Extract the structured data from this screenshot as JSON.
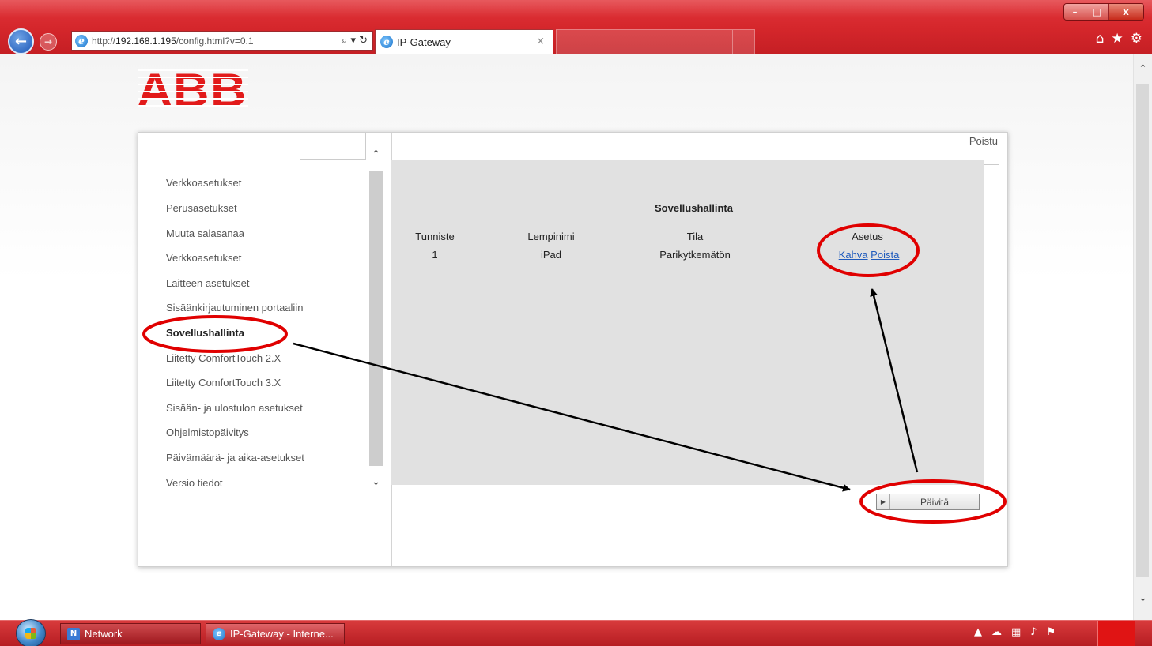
{
  "browser": {
    "url_prefix": "http://",
    "url_host": "192.168.1.195",
    "url_path": "/config.html?v=0.1",
    "tab_title": "IP-Gateway",
    "search_glyph": "⌕ ▾ ↻",
    "tab_close_glyph": "×",
    "toolbar_icons": [
      "home-icon",
      "favorites-icon",
      "tools-icon"
    ],
    "window_controls": [
      "–",
      "□",
      "x"
    ]
  },
  "logo": {
    "letters": [
      "A",
      "B",
      "B"
    ],
    "color": "#e21b1b"
  },
  "sidebar": {
    "items": [
      {
        "label": "Verkkoasetukset",
        "active": false
      },
      {
        "label": "Perusasetukset",
        "active": false
      },
      {
        "label": "Muuta salasanaa",
        "active": false
      },
      {
        "label": "Verkkoasetukset",
        "active": false
      },
      {
        "label": "Laitteen asetukset",
        "active": false
      },
      {
        "label": "Sisäänkirjautuminen portaaliin",
        "active": false
      },
      {
        "label": "Sovellushallinta",
        "active": true
      },
      {
        "label": "Liitetty ComfortTouch 2.X",
        "active": false
      },
      {
        "label": "Liitetty ComfortTouch 3.X",
        "active": false
      },
      {
        "label": "Sisään- ja ulostulon asetukset",
        "active": false
      },
      {
        "label": "Ohjelmistopäivitys",
        "active": false
      },
      {
        "label": "Päivämäärä- ja aika-asetukset",
        "active": false
      },
      {
        "label": "Versio tiedot",
        "active": false
      }
    ]
  },
  "header": {
    "logout_label": "Poistu"
  },
  "content": {
    "title": "Sovellushallinta",
    "columns": [
      "Tunniste",
      "Lempinimi",
      "Tila",
      "Asetus"
    ],
    "rows": [
      {
        "id": "1",
        "nickname": "iPad",
        "status": "Parikytkemätön",
        "actions": [
          "Kahva",
          "Poista"
        ]
      }
    ],
    "update_button_label": "Päivitä"
  },
  "taskbar": {
    "items": [
      {
        "label": "Network"
      },
      {
        "label": "IP-Gateway - Interne..."
      }
    ],
    "tray_icons": [
      "arrow-up-icon",
      "cloud-icon",
      "network-icon",
      "volume-icon",
      "flag-icon"
    ]
  },
  "colors": {
    "chrome_red": "#d4262b",
    "annotation_red": "#e00000",
    "link_blue": "#1f5bbd",
    "content_gray": "#e1e1e1"
  }
}
